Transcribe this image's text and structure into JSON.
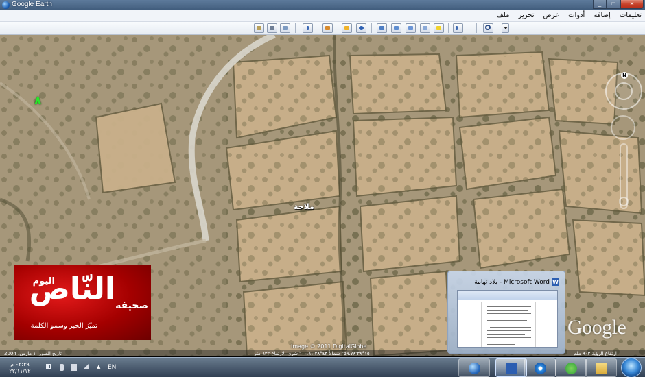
{
  "window": {
    "title": "Google Earth"
  },
  "menu": [
    "ملف",
    "تحرير",
    "عرض",
    "أدوات",
    "إضافة",
    "تعليمات"
  ],
  "toolbar": [
    "sidebar",
    "placemark",
    "polygon",
    "path",
    "image-overlay",
    "record-tour",
    "historical-imagery",
    "sunlight",
    "switch-to-sky",
    "ruler",
    "email",
    "print",
    "save-image",
    "search-icon",
    "options-arrow"
  ],
  "map": {
    "place_label": "ملاحة",
    "hud_number": "٨",
    "image_credit": "Image © 2011 DigitalGlobe",
    "status_left": "تاريخ الصور: ١ مارس، 2004",
    "status_mid": "١٥°٣٨'٥٩.٧٨\" شمالاً  ٤٣°٢٨'٠٠.٦١\" شرق  الارتفاع ٦٣٢ متر",
    "status_right": "ارتفاع الرؤية ٩٠٣ ملم",
    "google_logo": "Google"
  },
  "news_logo": {
    "top_word": "اليوم",
    "big_word": "النّاص",
    "side_word": "صحيفة",
    "tagline": "تميّز الخبر وسمو الكلمة"
  },
  "preview": {
    "title": "بلاد تهامة - Microsoft Word"
  },
  "taskbar": {
    "time": "٠٢:٣٩ م",
    "date": "٢٢/١١/١٢",
    "language": "EN"
  }
}
